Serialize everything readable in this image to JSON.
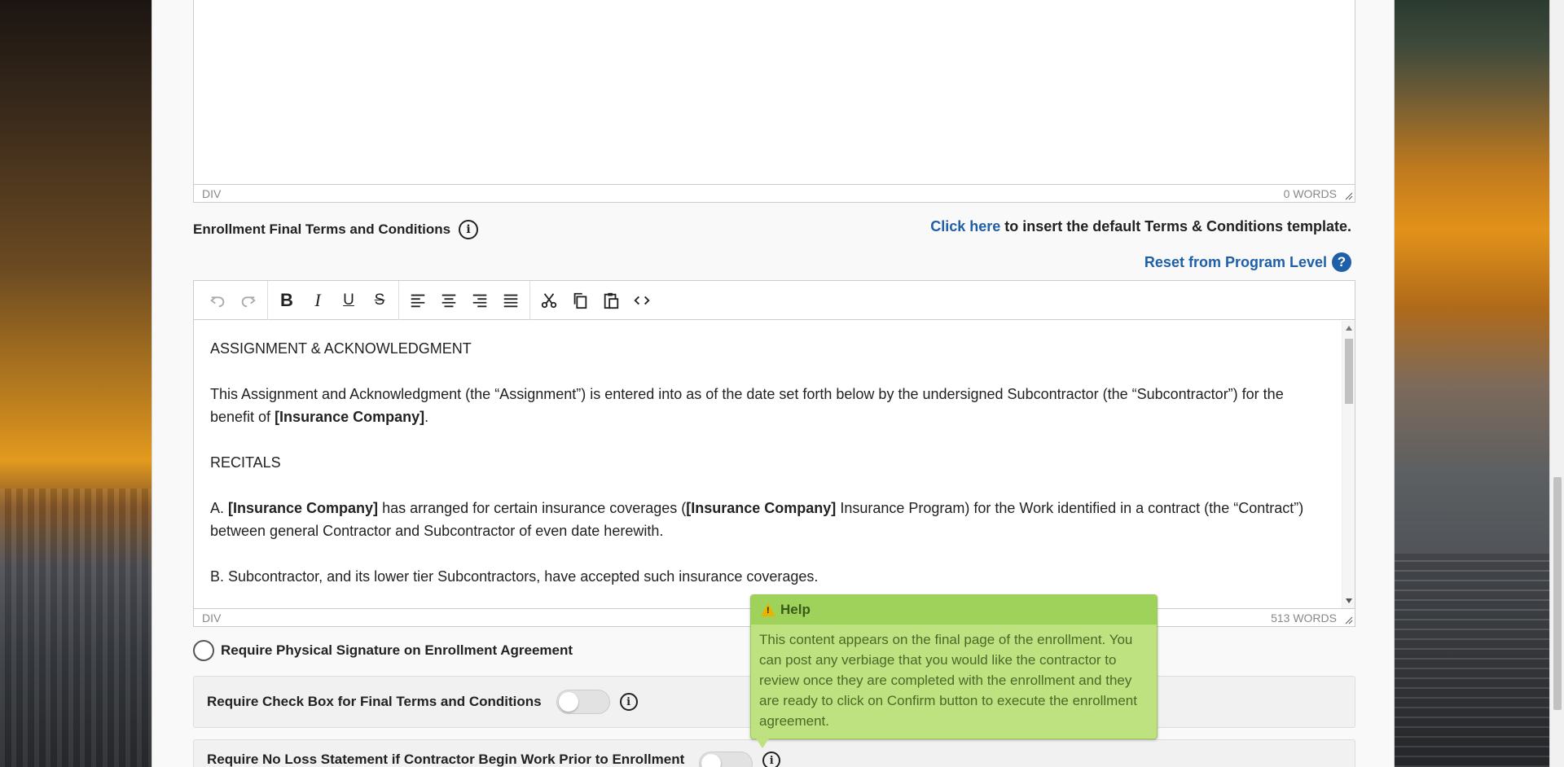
{
  "top_editor": {
    "status_element": "DIV",
    "word_count": "0 WORDS"
  },
  "terms_section": {
    "title": "Enrollment Final Terms and Conditions",
    "insert_link": "Click here",
    "insert_text": " to insert the default Terms & Conditions template.",
    "reset_link": "Reset from Program Level"
  },
  "toolbar": {
    "buttons": [
      "undo",
      "redo",
      "bold",
      "italic",
      "underline",
      "strikethrough",
      "align-left",
      "align-center",
      "align-right",
      "align-justify",
      "cut",
      "copy",
      "paste",
      "source-code"
    ]
  },
  "editor_content": {
    "heading": "ASSIGNMENT & ACKNOWLEDGMENT",
    "p1_a": "This Assignment and Acknowledgment (the “Assignment”) is entered into as of the date set forth below by the undersigned Subcontractor (the “Subcontractor”) for the benefit of ",
    "p1_bold": "[Insurance Company]",
    "p1_end": ".",
    "recitals": "RECITALS",
    "pa_prefix": "A. ",
    "pa_bold1": "[Insurance Company]",
    "pa_mid": " has arranged for certain insurance coverages (",
    "pa_bold2": "[Insurance Company]",
    "pa_end": " Insurance Program) for the Work identified in a contract (the “Contract”) between general Contractor and Subcontractor of even date herewith.",
    "pb": "B. Subcontractor, and its lower tier Subcontractors, have accepted such insurance coverages."
  },
  "main_editor": {
    "status_element": "DIV",
    "word_count": "513 WORDS"
  },
  "options": {
    "physical_signature": "Require Physical Signature on Enrollment Agreement",
    "check_box_terms": "Require Check Box for Final Terms and Conditions",
    "no_loss_statement": "Require No Loss Statement if Contractor Begin Work Prior to Enrollment"
  },
  "tooltip": {
    "title": "Help",
    "body": "This content appears on the final page of the enrollment. You can post any verbiage that you would like the contractor to review once they are completed with the enrollment and they are ready to click on Confirm button to execute the enrollment agreement."
  },
  "icons": {
    "info": "info-icon",
    "help": "help-icon",
    "warning": "warning-icon"
  },
  "colors": {
    "link": "#1f5fa8",
    "tooltip_bg": "#bde27f",
    "tooltip_header": "#9fd25a"
  }
}
